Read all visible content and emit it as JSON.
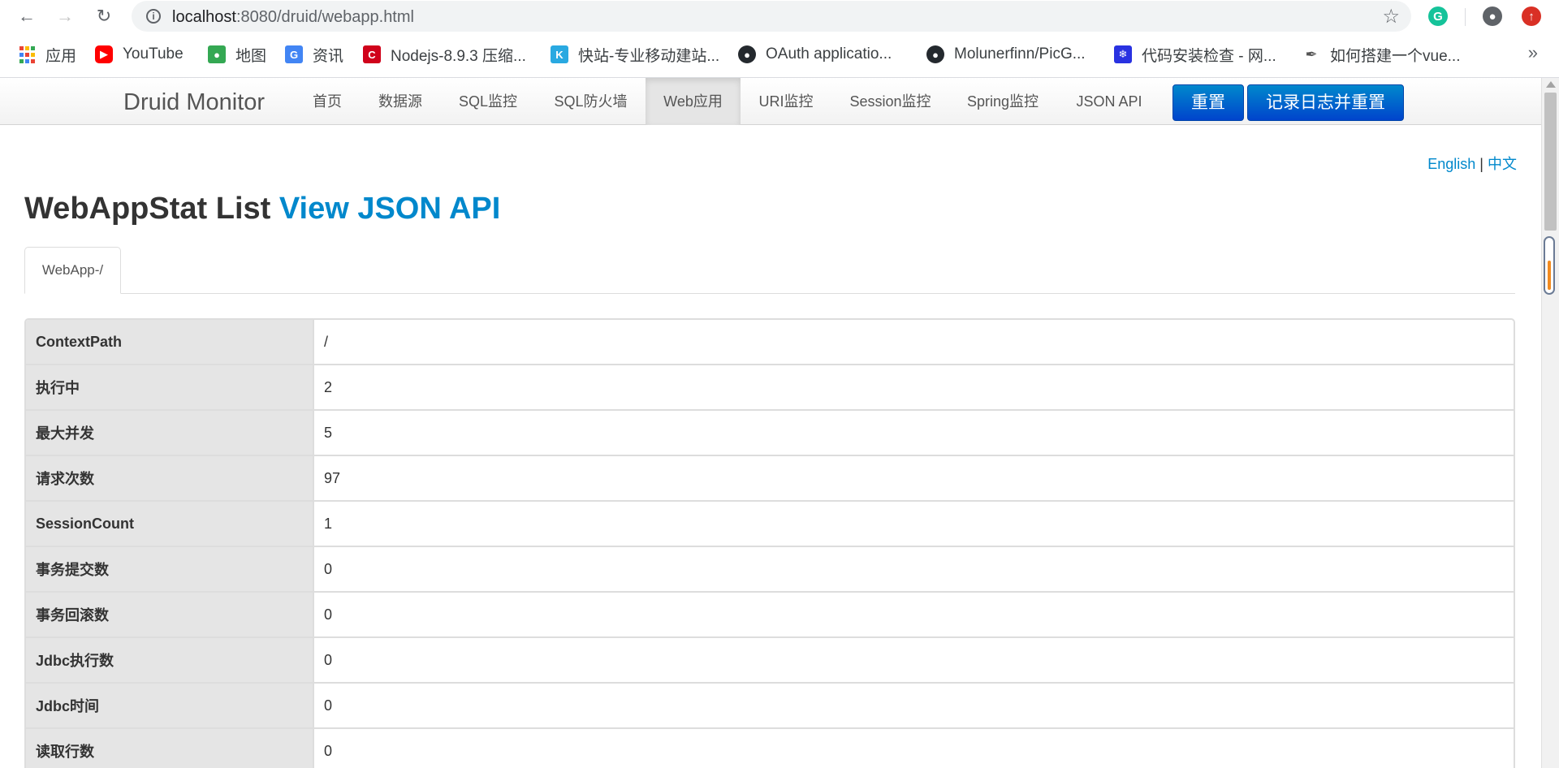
{
  "browser": {
    "url_host": "localhost",
    "url_rest": ":8080/druid/webapp.html",
    "bookmarks": [
      {
        "label": "应用",
        "icon": "apps-grid-icon"
      },
      {
        "label": "YouTube",
        "icon": "youtube-icon",
        "color": "#ff0000"
      },
      {
        "label": "地图",
        "icon": "maps-icon",
        "color": "#34a853"
      },
      {
        "label": "资讯",
        "icon": "news-icon",
        "color": "#4285f4"
      },
      {
        "label": "Nodejs-8.9.3 压缩...",
        "icon": "c-logo-icon",
        "color": "#d0021b"
      },
      {
        "label": "快站-专业移动建站...",
        "icon": "kuaizhan-icon",
        "color": "#29a9e1"
      },
      {
        "label": "OAuth applicatio...",
        "icon": "github-icon",
        "color": "#24292e"
      },
      {
        "label": "Molunerfinn/PicG...",
        "icon": "github-icon",
        "color": "#24292e"
      },
      {
        "label": "代码安装检查 - 网...",
        "icon": "baidu-paw-icon",
        "color": "#2932e1"
      },
      {
        "label": "如何搭建一个vue...",
        "icon": "feather-icon",
        "color": "#555555"
      }
    ]
  },
  "navbar": {
    "brand": "Druid Monitor",
    "items": [
      "首页",
      "数据源",
      "SQL监控",
      "SQL防火墙",
      "Web应用",
      "URI监控",
      "Session监控",
      "Spring监控",
      "JSON API"
    ],
    "active_index": 4,
    "reset_label": "重置",
    "log_reset_label": "记录日志并重置"
  },
  "lang": {
    "english": "English",
    "separator": "|",
    "chinese": "中文"
  },
  "title": {
    "text": "WebAppStat List",
    "link": "View JSON API"
  },
  "tab_label": "WebApp-/",
  "stats": [
    {
      "key": "ContextPath",
      "value": "/"
    },
    {
      "key": "执行中",
      "value": "2"
    },
    {
      "key": "最大并发",
      "value": "5"
    },
    {
      "key": "请求次数",
      "value": "97"
    },
    {
      "key": "SessionCount",
      "value": "1"
    },
    {
      "key": "事务提交数",
      "value": "0"
    },
    {
      "key": "事务回滚数",
      "value": "0"
    },
    {
      "key": "Jdbc执行数",
      "value": "0"
    },
    {
      "key": "Jdbc时间",
      "value": "0"
    },
    {
      "key": "读取行数",
      "value": "0"
    }
  ],
  "colors": {
    "accent": "#0088cc",
    "primary_button": "#0055cc",
    "key_column_bg": "#e5e5e5"
  }
}
